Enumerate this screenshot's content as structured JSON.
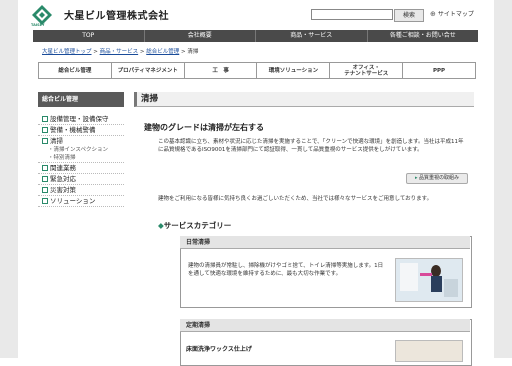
{
  "header": {
    "company_name": "大星ビル管理株式会社",
    "logo_text": "TAISEY",
    "search_button": "検索",
    "sitemap_label": "サイトマップ"
  },
  "global_nav": [
    "TOP",
    "会社概要",
    "商品・サービス",
    "各種ご相談・お問い合せ"
  ],
  "breadcrumb": {
    "items": [
      "大星ビル管理トップ",
      "商品・サービス",
      "総合ビル管理"
    ],
    "current": "清掃"
  },
  "sub_nav": [
    "総合ビル管理",
    "プロパティマネジメント",
    "工　事",
    "環境ソリューション",
    "オフィス・\nテナントサービス",
    "PPP"
  ],
  "sidebar": {
    "title": "総合ビル管理",
    "items": [
      {
        "label": "設備管理・設備保守"
      },
      {
        "label": "警備・機械警備"
      },
      {
        "label": "清掃"
      },
      {
        "label": "関連業務"
      },
      {
        "label": "緊急対応"
      },
      {
        "label": "災害対策"
      },
      {
        "label": "ソリューション"
      }
    ],
    "sub_items": [
      "清掃インスペクション",
      "特別清掃"
    ]
  },
  "main": {
    "page_title": "清掃",
    "headline": "建物のグレードは清掃が左右する",
    "intro": "この基本認識に立ち、素材や状況に応じた清掃を実施することで、「クリーンで快適な環境」を創造します。当社は平成11年に品質規格であるISO9001を清掃部門にて認証取得、一貫して品質重視のサービス提供をしがけています。",
    "quality_link": "品質重視の取組み",
    "usage_text": "建物をご利用になる皆様に気持ち良くお過ごしいただくため、当社では様々なサービスをご用意しております。",
    "category_heading": "サービスカテゴリー",
    "category_marker": "◆",
    "daily": {
      "title": "日常清掃",
      "text": "建物の清掃員が常駐し、掃除機がけやゴミ捨て、トイレ清掃等実施します。1日を通して快適な環境を維持するために、最も大切な作業です。"
    },
    "periodic": {
      "title": "定期清掃",
      "subtitle": "床面洗浄ワックス仕上げ"
    }
  },
  "colors": {
    "accent_green": "#2a8a6a",
    "nav_dark": "#4a4a4a",
    "link_blue": "#1a4c9a"
  }
}
